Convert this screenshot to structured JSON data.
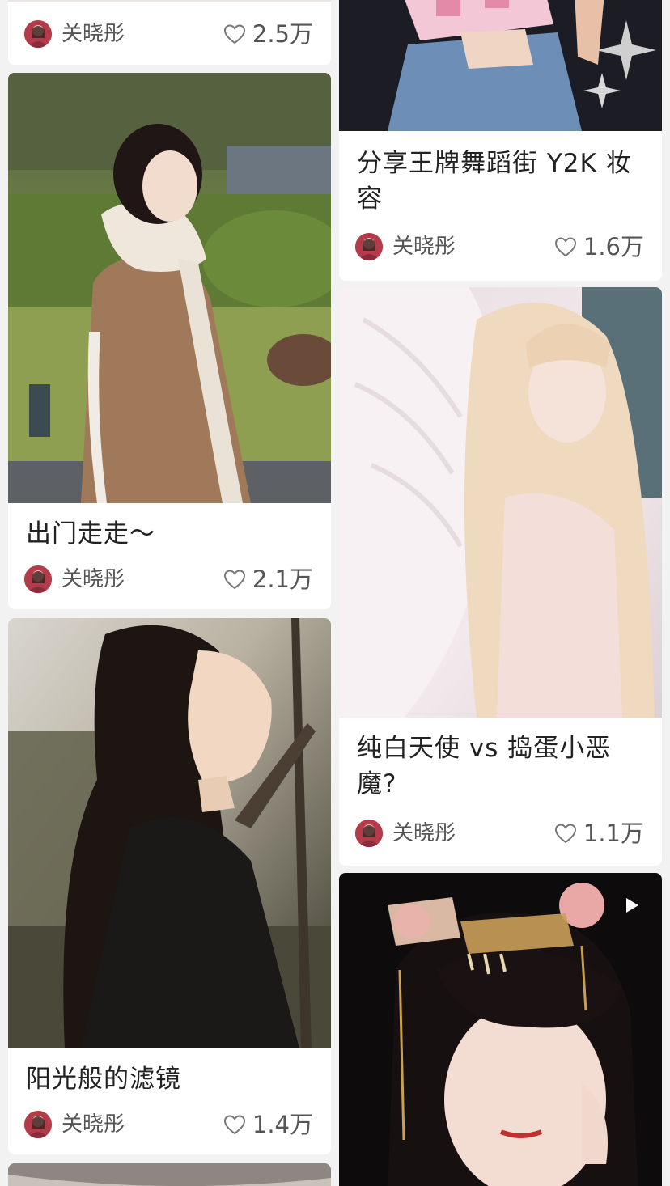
{
  "feed": {
    "cards": [
      {
        "title": "",
        "author": "关晓彤",
        "likes": "2.5万"
      },
      {
        "title": "出门走走～",
        "author": "关晓彤",
        "likes": "2.1万"
      },
      {
        "title": "阳光般的滤镜",
        "author": "关晓彤",
        "likes": "1.4万"
      },
      {
        "title": "分享王牌舞蹈街 Y2K 妆容",
        "author": "关晓彤",
        "likes": "1.6万"
      },
      {
        "title": "纯白天使 vs 捣蛋小恶魔?",
        "author": "关晓彤",
        "likes": "1.1万"
      }
    ]
  },
  "icons": {
    "like": "heart-outline-icon",
    "video": "play-icon"
  },
  "colors": {
    "background": "#f2f2f2",
    "card": "#ffffff",
    "title_text": "#222222",
    "meta_text": "#555555"
  }
}
